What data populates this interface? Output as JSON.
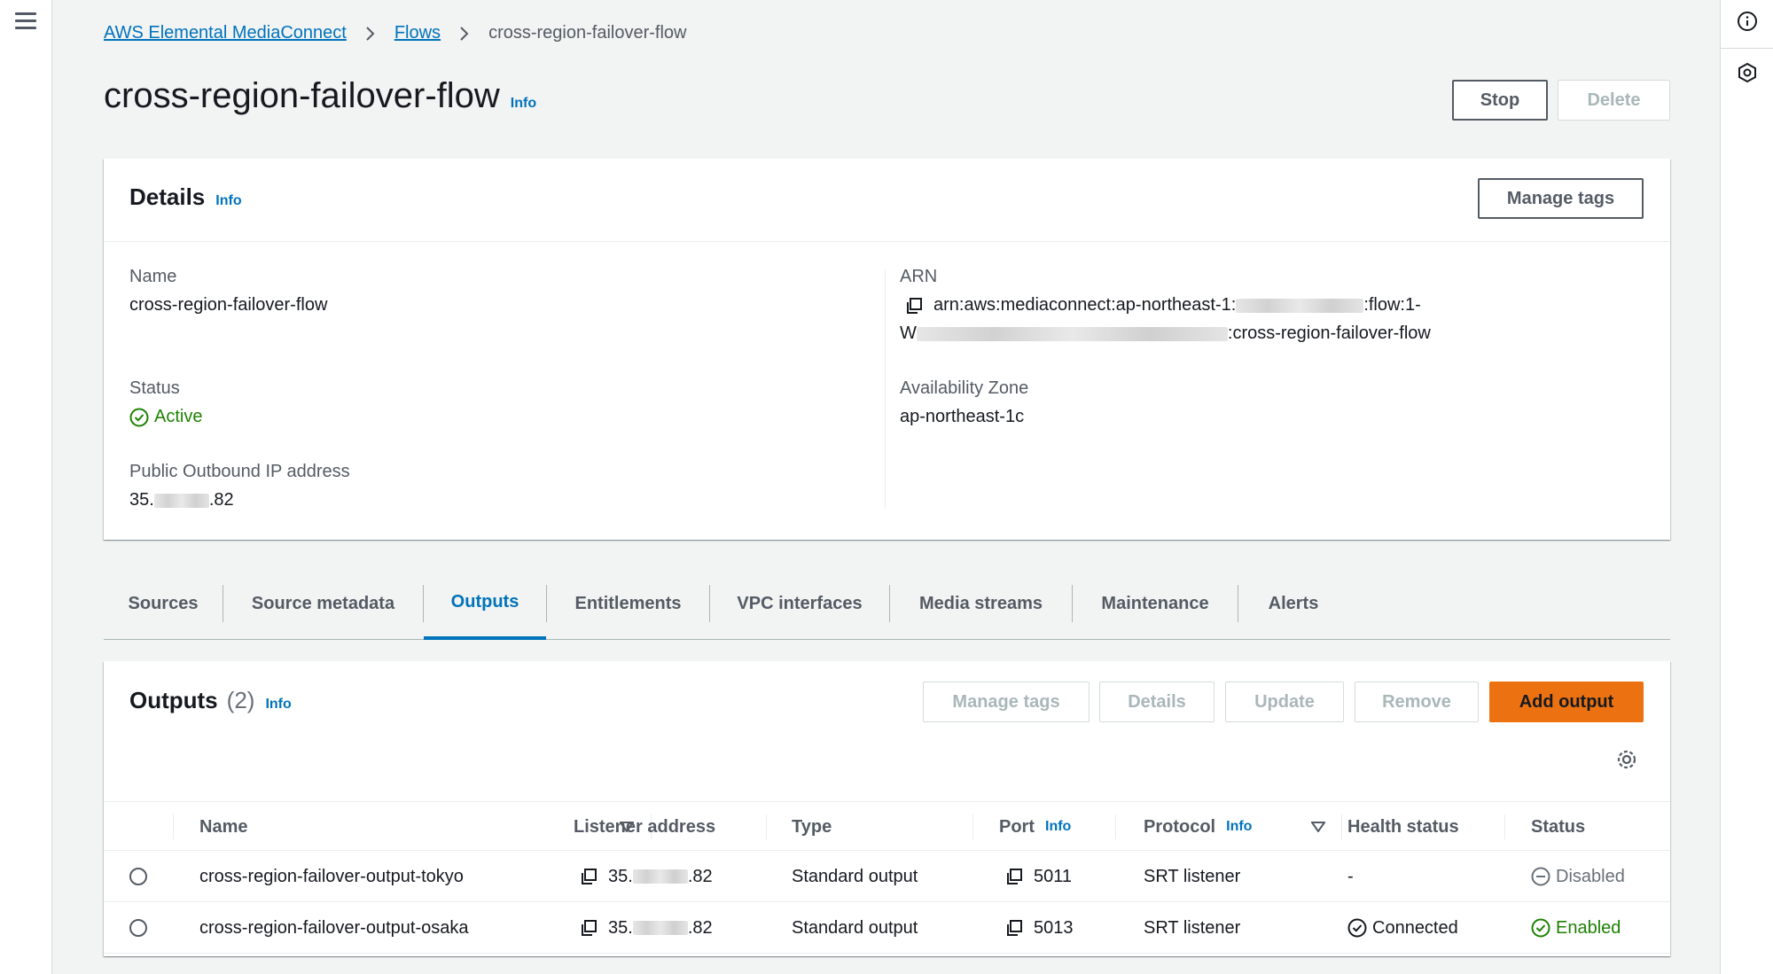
{
  "breadcrumb": {
    "service": "AWS Elemental MediaConnect",
    "flows": "Flows",
    "current": "cross-region-failover-flow"
  },
  "header": {
    "title": "cross-region-failover-flow",
    "info": "Info",
    "stop_label": "Stop",
    "delete_label": "Delete"
  },
  "details": {
    "title": "Details",
    "info": "Info",
    "manage_tags_label": "Manage tags",
    "name_label": "Name",
    "name_value": "cross-region-failover-flow",
    "status_label": "Status",
    "status_value": "Active",
    "ip_label": "Public Outbound IP address",
    "ip_prefix": "35.",
    "ip_suffix": ".82",
    "arn_label": "ARN",
    "arn_line1_prefix": "arn:aws:mediaconnect:ap-northeast-1:",
    "arn_line1_suffix": ":flow:1-",
    "arn_line2_prefix": "W",
    "arn_line2_suffix": ":cross-region-failover-flow",
    "az_label": "Availability Zone",
    "az_value": "ap-northeast-1c"
  },
  "tabs": [
    {
      "label": "Sources"
    },
    {
      "label": "Source metadata"
    },
    {
      "label": "Outputs"
    },
    {
      "label": "Entitlements"
    },
    {
      "label": "VPC interfaces"
    },
    {
      "label": "Media streams"
    },
    {
      "label": "Maintenance"
    },
    {
      "label": "Alerts"
    }
  ],
  "active_tab": "Outputs",
  "outputs": {
    "title": "Outputs",
    "count": "(2)",
    "info": "Info",
    "buttons": {
      "manage_tags": "Manage tags",
      "details": "Details",
      "update": "Update",
      "remove": "Remove",
      "add_output": "Add output"
    },
    "columns": {
      "name": "Name",
      "listener": "Listener address",
      "type": "Type",
      "port": "Port",
      "port_info": "Info",
      "protocol": "Protocol",
      "protocol_info": "Info",
      "health": "Health status",
      "status": "Status"
    },
    "rows": [
      {
        "name": "cross-region-failover-output-tokyo",
        "ip_prefix": "35.",
        "ip_suffix": ".82",
        "type": "Standard output",
        "port": "5011",
        "protocol": "SRT listener",
        "health": "-",
        "status": "Disabled"
      },
      {
        "name": "cross-region-failover-output-osaka",
        "ip_prefix": "35.",
        "ip_suffix": ".82",
        "type": "Standard output",
        "port": "5013",
        "protocol": "SRT listener",
        "health": "Connected",
        "status": "Enabled"
      }
    ]
  },
  "colors": {
    "link": "#0073bb",
    "success": "#1d8102",
    "primary_button": "#ec7211",
    "background": "#f2f3f3"
  },
  "icons": [
    "menu-icon",
    "info-circle-icon",
    "gear-hex-icon",
    "chevron-right-icon",
    "copy-icon",
    "check-circle-icon",
    "minus-circle-icon",
    "settings-gear-icon",
    "sort-down-icon"
  ]
}
